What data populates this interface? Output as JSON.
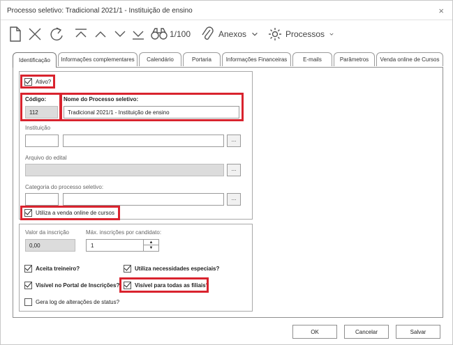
{
  "window": {
    "title": "Processo seletivo: Tradicional 2021/1 - Instituição de ensino",
    "close_glyph": "×"
  },
  "toolbar": {
    "icons": [
      "new-document-icon",
      "delete-icon",
      "refresh-icon",
      "first-record-icon",
      "previous-record-icon",
      "next-record-icon",
      "last-record-icon",
      "binoculars-icon",
      "paperclip-icon",
      "gear-icon"
    ],
    "record_counter": "1/100",
    "attachments_label": "Anexos",
    "processes_label": "Processos"
  },
  "tabs": [
    "Identificação",
    "Informações complementares",
    "Calendário",
    "Portaria",
    "Informações Financeiras",
    "E-mails",
    "Parâmetros",
    "Venda online de Cursos"
  ],
  "form": {
    "ativo_label": "Ativo?",
    "codigo_label": "Código:",
    "codigo_value": "112",
    "nome_label": "Nome do Processo seletivo:",
    "nome_value": "Tradicional 2021/1 - Instituição de ensino",
    "instituicao_label": "Instituição",
    "arquivo_label": "Arquivo do edital",
    "categoria_label": "Categoria do processo seletivo:",
    "dots": "...",
    "venda_online_label": "Utiliza a venda online de cursos",
    "valor_label": "Valor da inscrição",
    "valor_value": "0,00",
    "max_label": "Máx. inscrições por candidato:",
    "max_value": "1",
    "treineiro_label": "Aceita treineiro?",
    "necessidades_label": "Utiliza necessidades especiais?",
    "portal_label": "Visível no Portal de Inscrições?",
    "filiais_label": "Visível para todas as filiais?",
    "log_label": "Gera log de alterações de status?"
  },
  "footer": {
    "ok_label": "OK",
    "cancel_label": "Cancelar",
    "save_label": "Salvar"
  },
  "colors": {
    "highlight": "#d9232e",
    "disabled_field": "#dcdcdc",
    "border": "#9a9a9a"
  }
}
